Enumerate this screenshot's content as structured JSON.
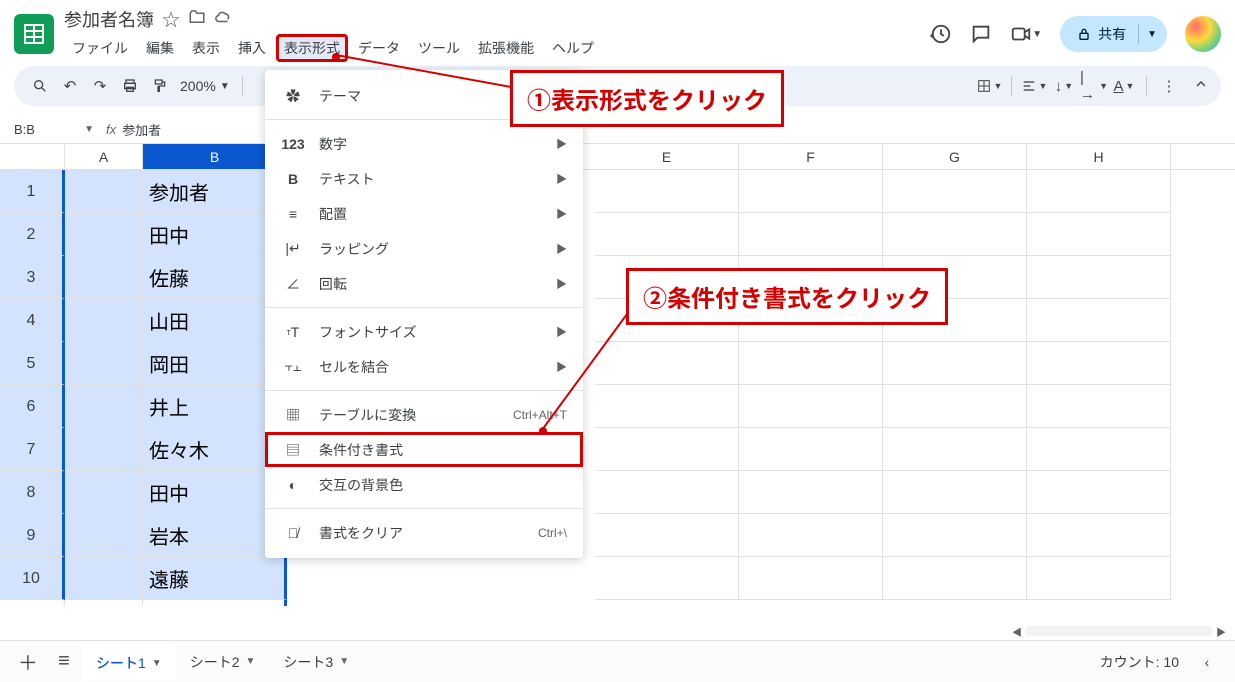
{
  "doc_title": "参加者名簿",
  "menus": {
    "file": "ファイル",
    "edit": "編集",
    "view": "表示",
    "insert": "挿入",
    "format": "表示形式",
    "data": "データ",
    "tools": "ツール",
    "extensions": "拡張機能",
    "help": "ヘルプ"
  },
  "share_label": "共有",
  "zoom": "200%",
  "namebox": "B:B",
  "fx_value": "参加者",
  "columns": [
    "A",
    "B",
    "E",
    "F",
    "G",
    "H"
  ],
  "rows": [
    {
      "n": "1",
      "b": "参加者"
    },
    {
      "n": "2",
      "b": "田中"
    },
    {
      "n": "3",
      "b": "佐藤"
    },
    {
      "n": "4",
      "b": "山田"
    },
    {
      "n": "5",
      "b": "岡田"
    },
    {
      "n": "6",
      "b": "井上"
    },
    {
      "n": "7",
      "b": "佐々木"
    },
    {
      "n": "8",
      "b": "田中"
    },
    {
      "n": "9",
      "b": "岩本"
    },
    {
      "n": "10",
      "b": "遠藤"
    }
  ],
  "dropdown": {
    "theme": "テーマ",
    "number": "数字",
    "text": "テキスト",
    "align": "配置",
    "wrap": "ラッピング",
    "rotate": "回転",
    "fontsize": "フォントサイズ",
    "merge": "セルを結合",
    "table": "テーブルに変換",
    "table_short": "Ctrl+Alt+T",
    "conditional": "条件付き書式",
    "altcolor": "交互の背景色",
    "clear": "書式をクリア",
    "clear_short": "Ctrl+\\"
  },
  "annotations": {
    "a1": "①表示形式をクリック",
    "a2": "②条件付き書式をクリック"
  },
  "sheets": {
    "s1": "シート1",
    "s2": "シート2",
    "s3": "シート3"
  },
  "count_label": "カウント: 10"
}
